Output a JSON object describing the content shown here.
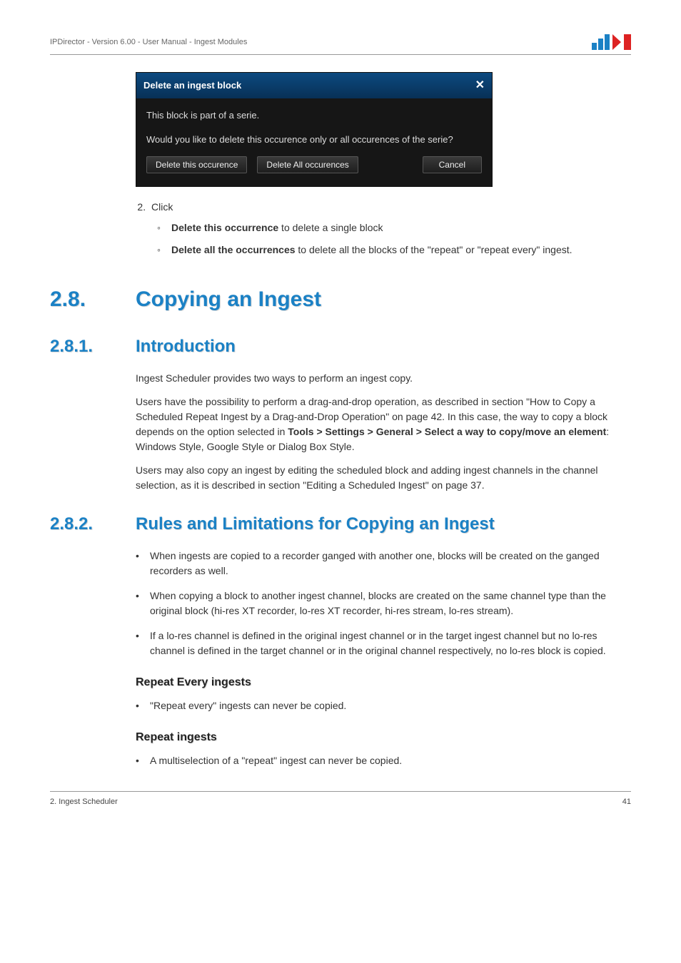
{
  "header": {
    "title": "IPDirector - Version 6.00 - User Manual - Ingest Modules"
  },
  "dialog": {
    "title": "Delete an ingest block",
    "close": "✕",
    "line1": "This block is part of a serie.",
    "line2": "Would you like to delete this occurence only or all occurences of the serie?",
    "btn_delete_this": "Delete this occurence",
    "btn_delete_all": "Delete All occurences",
    "btn_cancel": "Cancel"
  },
  "step2": {
    "num_label": "Click",
    "opt1_bold": "Delete this occurrence",
    "opt1_rest": " to delete a single block",
    "opt2_bold": "Delete all the occurrences",
    "opt2_rest": " to delete all the blocks of the \"repeat\" or \"repeat every\" ingest."
  },
  "sec28": {
    "num": "2.8.",
    "title": "Copying an Ingest"
  },
  "sec281": {
    "num": "2.8.1.",
    "title": "Introduction",
    "p1": "Ingest Scheduler provides two ways to perform an ingest copy.",
    "p2_a": "Users have the possibility to perform a drag-and-drop operation, as described in section \"How to Copy a Scheduled Repeat Ingest by a Drag-and-Drop Operation\" on page 42. In this case, the way to copy a block depends on the option selected in ",
    "p2_b": "Tools > Settings > General > Select a way to copy/move an element",
    "p2_c": ": Windows Style, Google Style or Dialog Box Style.",
    "p3": "Users may also copy an ingest by editing the scheduled block and adding ingest channels in the channel selection, as it is described in section \"Editing a Scheduled Ingest\" on page 37."
  },
  "sec282": {
    "num": "2.8.2.",
    "title": "Rules and Limitations for Copying an Ingest",
    "b1": "When ingests are copied to a recorder ganged with another one, blocks will be created on the ganged recorders as well.",
    "b2": "When copying a block to another ingest channel, blocks are created on the same channel type than the original block (hi-res XT recorder, lo-res XT recorder, hi-res stream, lo-res stream).",
    "b3": "If a lo-res channel is defined in the original ingest channel or in the target ingest channel but no lo-res channel is defined in the target channel or in the original channel respectively, no lo-res block is copied.",
    "h_repeat_every": "Repeat Every ingests",
    "re1": "\"Repeat every\" ingests can never be copied.",
    "h_repeat": "Repeat ingests",
    "r1": "A multiselection of a \"repeat\" ingest can never be copied."
  },
  "footer": {
    "left": "2. Ingest Scheduler",
    "right": "41"
  }
}
